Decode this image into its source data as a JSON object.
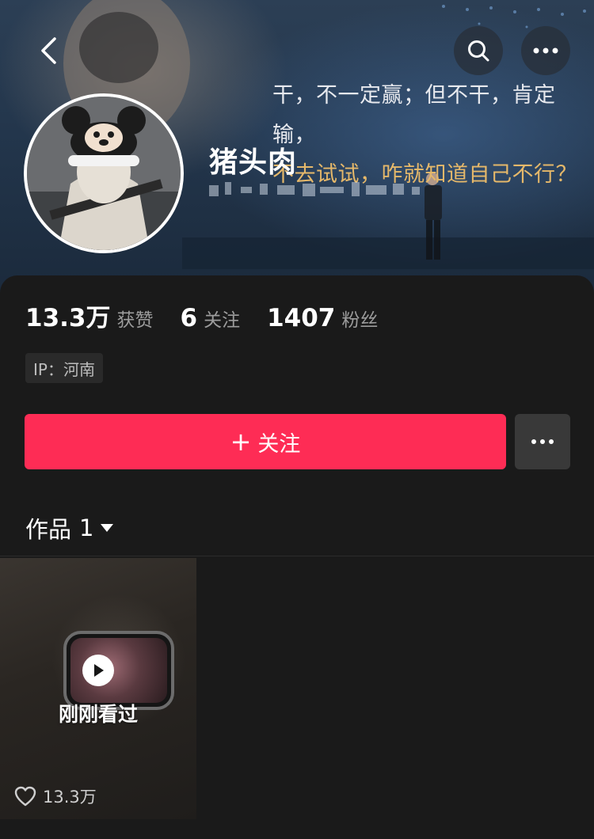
{
  "header": {
    "quote_line1": "干，不一定赢；但不干，肯定输，",
    "quote_line2": "不去试试，咋就知道自己不行？"
  },
  "profile": {
    "username": "猪头肉"
  },
  "stats": [
    {
      "value": "13.3万",
      "label": "获赞"
    },
    {
      "value": "6",
      "label": "关注"
    },
    {
      "value": "1407",
      "label": "粉丝"
    }
  ],
  "ip_tag": "IP：河南",
  "follow_button": {
    "label": "关注",
    "accent": "#fe2c55"
  },
  "works_tab": {
    "label": "作品",
    "count": "1"
  },
  "videos": [
    {
      "overlay": "刚刚看过",
      "likes": "13.3万"
    }
  ],
  "icons": {
    "back": "chevron-left-icon",
    "search": "search-icon",
    "more": "more-horizontal-icon",
    "play": "play-icon",
    "heart": "heart-outline-icon",
    "caret": "caret-down-icon"
  }
}
